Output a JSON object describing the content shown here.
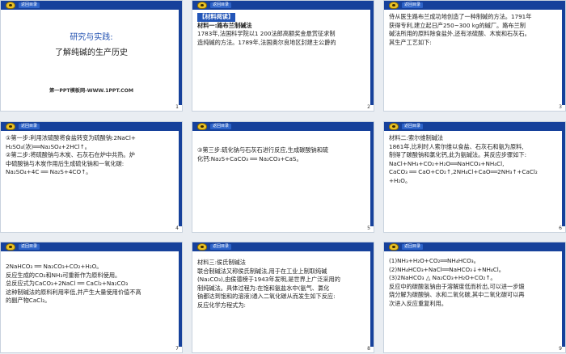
{
  "back_label": "返回目录",
  "slides": [
    {
      "num": "1",
      "title_line1": "研究与实践:",
      "title_line2": "了解纯碱的生产历史",
      "footer": "第一PPT模板网-WWW.1PPT.COM"
    },
    {
      "num": "2",
      "lines": [
        "【材料阅读】",
        "材料一:路布兰制碱法",
        "1783年,法国科学院以1 200法郎高额奖金悬赏征求制",
        "造纯碱的方法。1789年,法国奥尔良地区封建主公爵的"
      ]
    },
    {
      "num": "3",
      "lines": [
        "侍从医生路布兰成功地创造了一种制碱的方法。1791年",
        "获得专利,建立起日产250~300 kg的碱厂。路布兰制",
        "碱法所用的原料除食盐外,还有浓硫酸、木炭和石灰石。",
        "其生产工艺如下:"
      ]
    },
    {
      "num": "4",
      "lines": [
        "①第一步:利用浓硫酸将食盐转变为硫酸钠:2NaCl+",
        "H₂SO₄(浓)══Na₂SO₄+2HCl↑。",
        "②第二步:将硫酸钠与木炭、石灰石在炉中共热。炉",
        "中硫酸钠与木炭作用后生成硫化钠和一氧化碳:",
        "Na₂SO₄+4C ══ Na₂S+4CO↑。"
      ]
    },
    {
      "num": "5",
      "lines": [
        "③第三步:硫化钠与石灰石进行反应,生成碳酸钠和硫",
        "化钙:Na₂S+CaCO₃ ══ Na₂CO₃+CaS。"
      ]
    },
    {
      "num": "6",
      "lines": [
        "材料二:索尔维制碱法",
        "1861年,比利时人索尔维以食盐、石灰石和氨为原料,",
        "制得了碳酸钠和氯化钙,此为氨碱法。其反应步骤如下:",
        "NaCl+NH₃+CO₂+H₂O══NaHCO₃+NH₄Cl,",
        "CaCO₃ ══ CaO+CO₂↑,2NH₄Cl+CaO══2NH₃↑+CaCl₂",
        "+H₂O。"
      ]
    },
    {
      "num": "7",
      "lines": [
        "2NaHCO₃ ══ Na₂CO₃+CO₂+H₂O。",
        "反应生成的CO₂和NH₃可重新作为原料使用。",
        "总反应式为CaCO₃+2NaCl ══ CaCl₂+Na₂CO₃",
        "这种制碱法的原料利用率低,并产生大量使用价值不高",
        "的副产物CaCl₂。"
      ]
    },
    {
      "num": "8",
      "lines": [
        "材料三:侯氏制碱法",
        "联合制碱法又称侯氏制碱法,用于在工业上制取纯碱",
        "(Na₂CO₃),由侯德榜于1943年发明,是世界上广泛采用的",
        "制纯碱法。具体过程为:在饱和氨盐水中(氨气、氯化",
        "钠都达到饱和的溶液)通入二氧化碳从而发生如下反应:",
        "反应化学方程式为:"
      ]
    },
    {
      "num": "9",
      "lines": [
        "(1)NH₃+H₂O+CO₂══NH₄HCO₃。",
        "(2)NH₄HCO₃+NaCl══NaHCO₃↓+NH₄Cl。",
        "(3)2NaHCO₃ △ Na₂CO₃+H₂O+CO₂↑。",
        "反应中的碳酸氢钠由于溶解度低而析出,可以进一步煅",
        "烧分解为碳酸钠、水和二氧化碳,其中二氧化碳可以再",
        "次进入反应重复利用。"
      ]
    }
  ]
}
